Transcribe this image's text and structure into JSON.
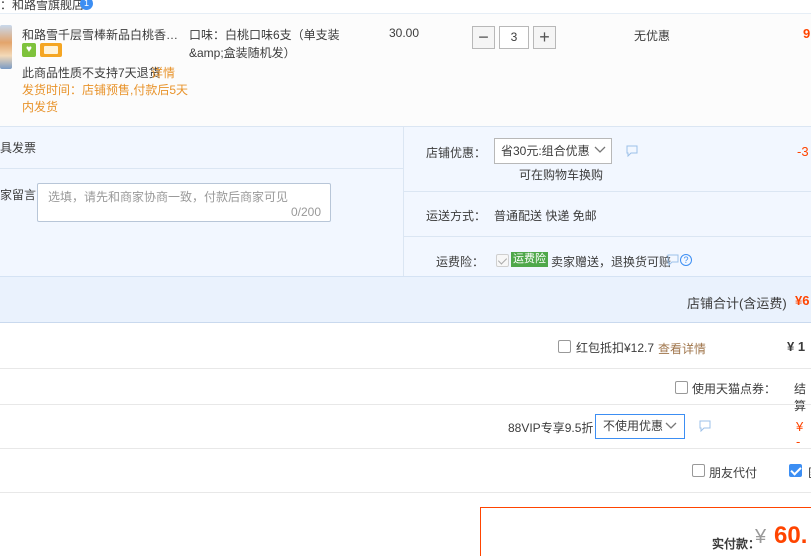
{
  "shop": {
    "name": "：和路雪旗舰店",
    "badge": "1"
  },
  "item": {
    "title": "和路雪千层雪棒新品白桃香草味...",
    "no_return": "此商品性质不支持7天退货",
    "detail_link": "详情",
    "ship_time": "发货时间：店铺预售,付款后5天内发货",
    "attr": "口味：白桃口味6支（单支装&amp;盒装随机发）",
    "price": "30.00",
    "qty": "3",
    "discount": "无优惠",
    "subtotal": "9"
  },
  "invoice": {
    "label": "具发票"
  },
  "message": {
    "label": "家留言：",
    "placeholder": "选填，请先和商家协商一致，付款后商家可见",
    "count": "0/200"
  },
  "shop_promo": {
    "label": "店铺优惠：",
    "selected": "省30元:组合优惠",
    "cart_swap": "可在购物车换购",
    "amount": "-3"
  },
  "shipping": {
    "label": "运送方式：",
    "value": "普通配送 快递 免邮"
  },
  "insurance": {
    "label": "运费险：",
    "tag": "运费险",
    "text": "卖家赠送，退换货可赔"
  },
  "shop_total": {
    "label": "店铺合计(含运费)",
    "value": "¥6"
  },
  "red_packet": {
    "label": "红包抵扣¥12.7",
    "link": "查看详情",
    "value": "¥ 1"
  },
  "tmall_points": {
    "label": "使用天猫点券：",
    "link": "结算"
  },
  "vip": {
    "label": "88VIP专享9.5折",
    "selected": "不使用优惠",
    "value": "¥ -"
  },
  "friend_pay": {
    "label": "朋友代付"
  },
  "anonymous": {
    "label": "匿"
  },
  "payment": {
    "label": "实付款：",
    "yen": "¥",
    "value": "60."
  },
  "colors": {
    "accent": "#3c8ef3",
    "price": "#ff4400",
    "warning": "#e8932b"
  }
}
